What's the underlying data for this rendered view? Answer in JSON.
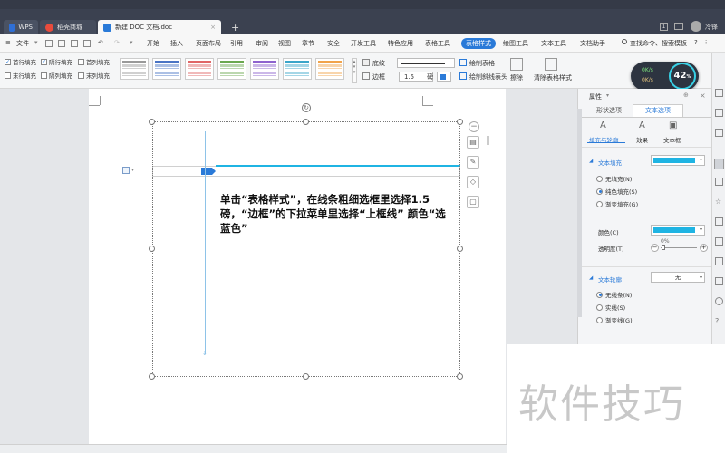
{
  "tabs": {
    "wps": "WPS",
    "store": "稻壳商城",
    "doc": "新建 DOC 文档.doc",
    "add": "+"
  },
  "window": {
    "badge": "1",
    "user": "冷锋"
  },
  "menu": {
    "file": "文件",
    "items": [
      "开始",
      "插入",
      "页面布局",
      "引用",
      "审阅",
      "视图",
      "章节",
      "安全",
      "开发工具",
      "特色应用",
      "表格工具",
      "表格样式",
      "绘图工具",
      "文本工具",
      "文档助手"
    ],
    "search": "查找命令、搜索模板",
    "help": "?"
  },
  "ribbon": {
    "checks": [
      {
        "label": "首行填充",
        "checked": true
      },
      {
        "label": "隔行填充",
        "checked": true
      },
      {
        "label": "首列填充",
        "checked": false
      },
      {
        "label": "末行填充",
        "checked": false
      },
      {
        "label": "隔列填充",
        "checked": false
      },
      {
        "label": "末列填充",
        "checked": false
      }
    ],
    "shading": "底纹",
    "border": "边框",
    "line_width": "1.5",
    "line_unit": "磅",
    "draw_table": "绘制表格",
    "draw_diag": "绘制斜线表头",
    "erase": "擦除",
    "clear_style": "清除表格样式"
  },
  "speed": {
    "down": "0K/s",
    "up": "0K/s",
    "percent": "42",
    "unit": "%"
  },
  "annotation": "单击“表格样式”，在线条粗细选框里选择1.5磅，“边框”的下拉菜单里选择“上框线” 颜色“选蓝色”",
  "panel": {
    "title": "属性",
    "tab_shape": "形状选项",
    "tab_text": "文本选项",
    "sub_fill": "填充与轮廓",
    "sub_effect": "效果",
    "sub_textbox": "文本框",
    "text_fill": "文本填充",
    "fill_options": [
      {
        "label": "无填充(N)",
        "on": false
      },
      {
        "label": "纯色填充(S)",
        "on": true
      },
      {
        "label": "渐变填充(G)",
        "on": false
      }
    ],
    "color_label": "颜色(C)",
    "transparency_label": "透明度(T)",
    "transparency_value": "0%",
    "text_outline": "文本轮廓",
    "outline_value": "无",
    "outline_options": [
      {
        "label": "无线条(N)",
        "on": true
      },
      {
        "label": "实线(S)",
        "on": false
      },
      {
        "label": "渐变线(G)",
        "on": false
      }
    ]
  },
  "watermark": "软件技巧",
  "colors": {
    "accent": "#1fb4e3",
    "tab_active": "#2a7ad8",
    "wps_red": "#e94b3c"
  }
}
